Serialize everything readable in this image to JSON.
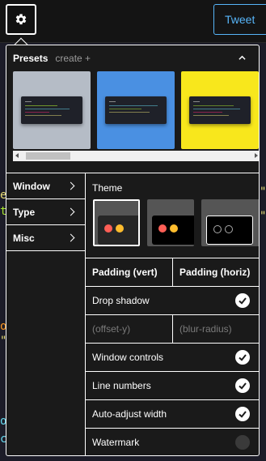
{
  "header": {
    "settings_icon": "gear-icon",
    "tweet_label": "Tweet"
  },
  "presets": {
    "title": "Presets",
    "create_label": "create +",
    "collapse_icon": "chevron-up-icon",
    "items": [
      {
        "name": "preset-1",
        "background": "#b5bcc6"
      },
      {
        "name": "preset-2",
        "background": "#4a90e2"
      },
      {
        "name": "preset-3",
        "background": "#f8e71c"
      }
    ]
  },
  "sidebar": {
    "items": [
      {
        "label": "Window"
      },
      {
        "label": "Type"
      },
      {
        "label": "Misc"
      }
    ]
  },
  "settings": {
    "theme_label": "Theme",
    "themes": [
      {
        "name": "theme-dark",
        "selected": true
      },
      {
        "name": "theme-black",
        "selected": false
      },
      {
        "name": "theme-outline",
        "selected": false
      }
    ],
    "padding_vert_label": "Padding (vert)",
    "padding_horiz_label": "Padding (horiz)",
    "drop_shadow_label": "Drop shadow",
    "drop_shadow_checked": true,
    "offset_y_placeholder": "(offset-y)",
    "blur_radius_placeholder": "(blur-radius)",
    "window_controls_label": "Window controls",
    "window_controls_checked": true,
    "line_numbers_label": "Line numbers",
    "line_numbers_checked": true,
    "auto_adjust_label": "Auto-adjust width",
    "auto_adjust_checked": true,
    "watermark_label": "Watermark",
    "watermark_checked": false
  },
  "colors": {
    "accent": "#57b5f9",
    "panel_bg": "#1a1a1a",
    "red_dot": "#ff5f56",
    "yellow_dot": "#ffbd2e"
  }
}
